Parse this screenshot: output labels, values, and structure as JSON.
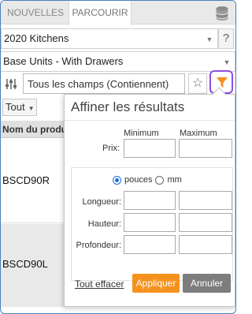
{
  "tabs": [
    {
      "label": "NOUVELLES"
    },
    {
      "label": "PARCOURIR"
    }
  ],
  "catalog_select": {
    "value": "2020 Kitchens"
  },
  "category_select": {
    "value": "Base Units - With Drawers"
  },
  "help": {
    "label": "?"
  },
  "search": {
    "value": "Tous les champs (Contiennent)"
  },
  "filter_dropdown": {
    "value": "Tout"
  },
  "table": {
    "column_header": "Nom du produit",
    "rows": [
      "BSCD90R",
      "BSCD90L"
    ]
  },
  "filter_panel": {
    "title": "Affiner les résultats",
    "minimum_label": "Minimum",
    "maximum_label": "Maximum",
    "price_label": "Prix:",
    "unit_options": [
      {
        "label": "pouces",
        "selected": true
      },
      {
        "label": "mm",
        "selected": false
      }
    ],
    "dimension_labels": [
      "Longueur:",
      "Hauteur:",
      "Profondeur:"
    ],
    "clear_label": "Tout effacer",
    "apply_label": "Appliquer",
    "cancel_label": "Annuler"
  },
  "colors": {
    "accent_orange": "#f5921e",
    "filter_highlight": "#8c4fe0",
    "cancel_gray": "#7d7d7d",
    "radio_blue": "#1f6ed8"
  },
  "icons": [
    "database-icon",
    "sliders-icon",
    "star-icon",
    "filter-icon",
    "chevron-down-icon",
    "help-icon"
  ]
}
